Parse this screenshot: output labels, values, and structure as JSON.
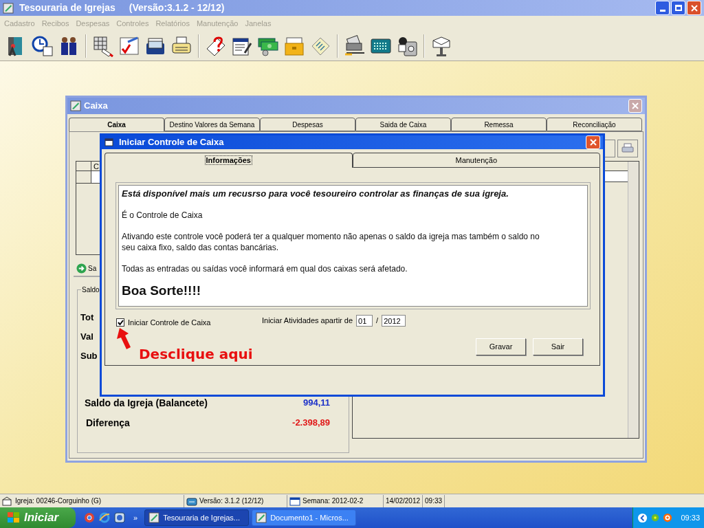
{
  "app": {
    "title": "Tesouraria de Igrejas",
    "version": "(Versão:3.1.2 - 12/12)"
  },
  "menu": [
    "Cadastro",
    "Recibos",
    "Despesas",
    "Controles",
    "Relatórios",
    "Manutenção",
    "Janelas"
  ],
  "caixa_window": {
    "title": "Caixa",
    "tabs": [
      {
        "label": "Caixa",
        "selected": true
      },
      {
        "label": "Destino Valores da Semana",
        "selected": false
      },
      {
        "label": "Despesas",
        "selected": false
      },
      {
        "label": "Saida de Caixa",
        "selected": false
      },
      {
        "label": "Remessa",
        "selected": false
      },
      {
        "label": "Reconciliação",
        "selected": false
      }
    ],
    "grid_header": "C",
    "side_button": "Sa",
    "group_label": "Saldo",
    "labels": [
      "Tot",
      "Val",
      "Sub"
    ],
    "saldo_igreja": {
      "label": "Saldo da Igreja (Balancete)",
      "value": "994,11"
    },
    "diferenca": {
      "label": "Diferença",
      "value": "-2.398,89"
    }
  },
  "dialog": {
    "title": "Iniciar Controle de Caixa",
    "tabs": [
      {
        "label": "Informações",
        "selected": true
      },
      {
        "label": "Manutenção",
        "selected": false
      }
    ],
    "info": {
      "heading": "Está disponível mais um recusrso para você tesoureiro controlar as finanças de sua igreja.",
      "paragraphs": [
        [
          "É o Controle de Caixa"
        ],
        [
          "Ativando este controle você poderá ter a qualquer momento não apenas o saldo da igreja mas também o saldo no",
          "seu caixa fixo, saldo das contas bancárias."
        ],
        [
          "Todas as entradas ou saídas você informará em qual dos caixas será afetado."
        ]
      ],
      "closing": "Boa Sorte!!!!"
    },
    "checkbox": {
      "label": "Iniciar Controle de Caixa",
      "checked": true
    },
    "start_label": "Iniciar Atividades apartir de",
    "month": "01",
    "separator": "/",
    "year": "2012",
    "buttons": [
      "Gravar",
      "Sair"
    ]
  },
  "annotation": "Desclique aqui",
  "status_bar": [
    {
      "kind": "church",
      "text": "Igreja: 00246-Corguinho (G)"
    },
    {
      "kind": "version",
      "text": "Versão: 3.1.2 (12/12)"
    },
    {
      "kind": "calendar",
      "text": "Semana: 2012-02-2"
    },
    {
      "kind": "plain",
      "text": "14/02/2012"
    },
    {
      "kind": "plain",
      "text": "09:33"
    }
  ],
  "taskbar": {
    "start": "Iniciar",
    "more": "»",
    "items": [
      {
        "label": "Tesouraria de Igrejas...",
        "selected": true
      },
      {
        "label": "Documento1 - Micros...",
        "selected": false
      }
    ],
    "time": "09:33"
  }
}
